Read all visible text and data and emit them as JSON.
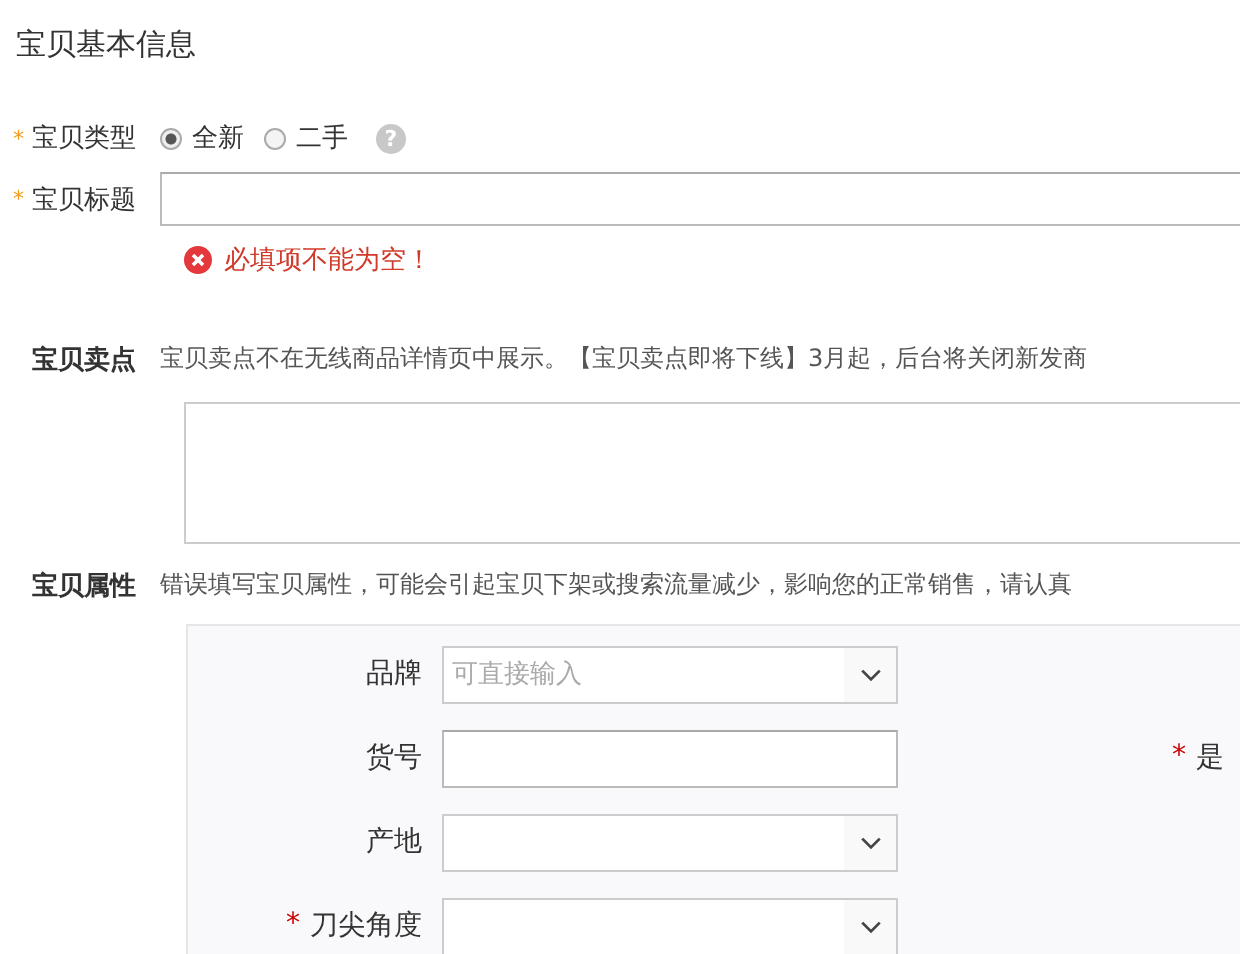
{
  "section_title": "宝贝基本信息",
  "type_field": {
    "required_mark": "*",
    "label": "宝贝类型",
    "options": [
      {
        "label": "全新",
        "selected": true
      },
      {
        "label": "二手",
        "selected": false
      }
    ],
    "help": "?"
  },
  "title_field": {
    "required_mark": "*",
    "label": "宝贝标题",
    "error": "必填项不能为空！"
  },
  "selling_point": {
    "label": "宝贝卖点",
    "note": "宝贝卖点不在无线商品详情页中展示。【宝贝卖点即将下线】3月起，后台将关闭新发商"
  },
  "attributes": {
    "label": "宝贝属性",
    "note": "错误填写宝贝属性，可能会引起宝贝下架或搜索流量减少，影响您的正常销售，请认真",
    "rows": [
      {
        "label": "品牌",
        "kind": "select",
        "placeholder": "可直接输入"
      },
      {
        "label": "货号",
        "kind": "text"
      },
      {
        "label": "产地",
        "kind": "select"
      },
      {
        "label": "刀尖角度",
        "kind": "select",
        "required_mark": "*"
      }
    ],
    "side_field": {
      "required_mark": "*",
      "label": "是"
    }
  }
}
